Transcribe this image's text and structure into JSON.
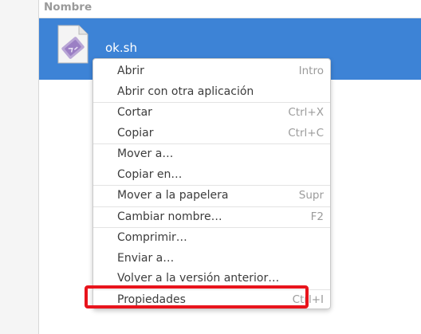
{
  "column_header": {
    "label": "Nombre"
  },
  "file": {
    "name": "ok.sh",
    "icon": "shell-script-file-icon"
  },
  "context_menu": {
    "sections": [
      [
        {
          "label": "Abrir",
          "accel": "Intro"
        },
        {
          "label": "Abrir con otra aplicación",
          "accel": ""
        }
      ],
      [
        {
          "label": "Cortar",
          "accel": "Ctrl+X"
        },
        {
          "label": "Copiar",
          "accel": "Ctrl+C"
        }
      ],
      [
        {
          "label": "Mover a…",
          "accel": ""
        },
        {
          "label": "Copiar en…",
          "accel": ""
        }
      ],
      [
        {
          "label": "Mover a la papelera",
          "accel": "Supr"
        }
      ],
      [
        {
          "label": "Cambiar nombre…",
          "accel": "F2"
        }
      ],
      [
        {
          "label": "Comprimir…",
          "accel": ""
        },
        {
          "label": "Enviar a…",
          "accel": ""
        },
        {
          "label": "Volver a la versión anterior…",
          "accel": ""
        }
      ],
      [
        {
          "label": "Propiedades",
          "accel": "Ctrl+I"
        }
      ]
    ]
  },
  "colors": {
    "selection": "#3d83d6",
    "highlight_border": "#e8141c"
  }
}
